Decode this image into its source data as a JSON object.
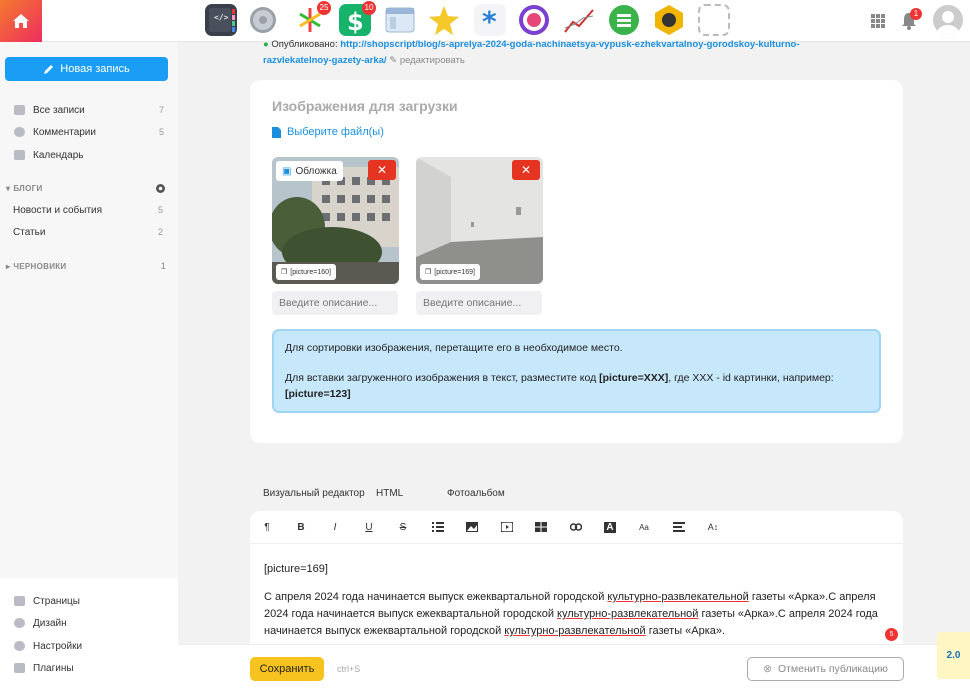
{
  "topbar": {
    "apps": [
      {
        "icon": "code-editor-icon",
        "badge": ""
      },
      {
        "icon": "gear-app-icon",
        "badge": ""
      },
      {
        "icon": "sparkle-app-icon",
        "badge": "25"
      },
      {
        "icon": "shop-dollar-icon",
        "badge": "10"
      },
      {
        "icon": "window-app-icon",
        "badge": ""
      },
      {
        "icon": "star-app-icon",
        "badge": ""
      },
      {
        "icon": "asterisk-app-icon",
        "badge": ""
      },
      {
        "icon": "photo-app-icon",
        "badge": ""
      },
      {
        "icon": "graph-app-icon",
        "badge": ""
      },
      {
        "icon": "list-app-icon",
        "badge": ""
      },
      {
        "icon": "hexagon-app-icon",
        "badge": ""
      },
      {
        "icon": "empty-slot-icon",
        "badge": ""
      }
    ],
    "bell_badge": "1"
  },
  "sidebar": {
    "new_post": "Новая запись",
    "items": [
      {
        "label": "Все записи",
        "count": "7"
      },
      {
        "label": "Комментарии",
        "count": "5"
      },
      {
        "label": "Календарь",
        "count": ""
      }
    ],
    "blogs_header": "БЛОГИ",
    "blogs": [
      {
        "label": "Новости и события",
        "count": "5"
      },
      {
        "label": "Статьи",
        "count": "2"
      }
    ],
    "drafts_header": "ЧЕРНОВИКИ",
    "drafts_count": "1",
    "bottom": [
      {
        "label": "Страницы"
      },
      {
        "label": "Дизайн"
      },
      {
        "label": "Настройки"
      },
      {
        "label": "Плагины"
      }
    ]
  },
  "post": {
    "published_label": "Опубликовано:",
    "url_line1": "http://shopscript/blog/s-aprelya-2024-goda-nachinaetsya-vypusk-ezhekvartalnoy-gorodskoy-kulturno-",
    "url_line2": "razvlekatelnoy-gazety-arka/",
    "edit_label": "редактировать"
  },
  "upload": {
    "title": "Изображения для загрузки",
    "choose_files": "Выберите файл(ы)",
    "cover_label": "Обложка",
    "images": [
      {
        "code": "[picture=160]",
        "placeholder": "Введите описание..."
      },
      {
        "code": "[picture=169]",
        "placeholder": "Введите описание..."
      }
    ],
    "info_sort": "Для сортировки изображения, перетащите его в необходимое место.",
    "info_insert_pre": "Для вставки загруженного изображения в текст, разместите код ",
    "info_insert_code": "[picture=XXX]",
    "info_insert_mid": ", где XXX - id картинки, например: ",
    "info_insert_example": "[picture=123]"
  },
  "editor": {
    "tabs": [
      "Визуальный редактор",
      "HTML",
      "Фотоальбом"
    ],
    "toolbar": [
      "¶",
      "B",
      "I",
      "U",
      "S",
      "list",
      "image",
      "video",
      "table",
      "link",
      "A",
      "Aa",
      "align",
      "A↕"
    ],
    "line1": "[picture=169]",
    "para_a": "С апреля 2024 года начинается выпуск ежеквартальной городской ",
    "para_b": "культурно-развлекательной",
    "para_c": " газеты «Арка».",
    "para_full": "С апреля 2024 года начинается выпуск ежеквартальной городской культурно-развлекательной газеты «Арка».С апреля 2024 года начинается выпуск ежеквартальной городской культурно-развлекательной газеты «Арка».С апреля 2024 года начинается выпуск ежеквартальной городской культурно-развлекательной газеты «Арка».",
    "error_count": "5"
  },
  "bottombar": {
    "save": "Сохранить",
    "shortcut": "ctrl+S",
    "unpublish": "Отменить публикацию",
    "version": "2.0"
  }
}
